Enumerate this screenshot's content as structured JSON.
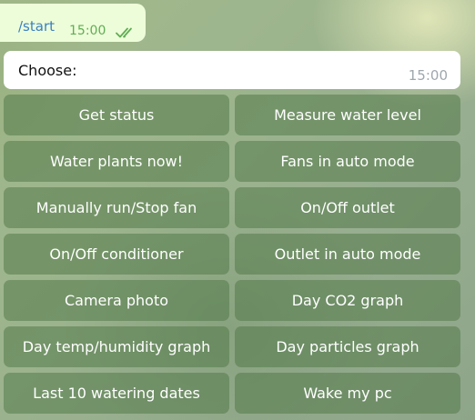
{
  "outgoing_message": {
    "text": "/start",
    "time": "15:00",
    "status_icon": "double-check-icon",
    "colors": {
      "bubble": "#eefdd9",
      "text": "#3a80c4",
      "time": "#5fad55"
    }
  },
  "incoming_message": {
    "text": "Choose:",
    "time": "15:00"
  },
  "keyboard": {
    "buttons": [
      [
        "Get status",
        "Measure water level"
      ],
      [
        "Water plants now!",
        "Fans in auto mode"
      ],
      [
        "Manually run/Stop fan",
        "On/Off outlet"
      ],
      [
        "On/Off conditioner",
        "Outlet in auto mode"
      ],
      [
        "Camera photo",
        "Day CO2 graph"
      ],
      [
        "Day temp/humidity graph",
        "Day particles graph"
      ],
      [
        "Last 10 watering dates",
        "Wake my pc"
      ]
    ]
  }
}
